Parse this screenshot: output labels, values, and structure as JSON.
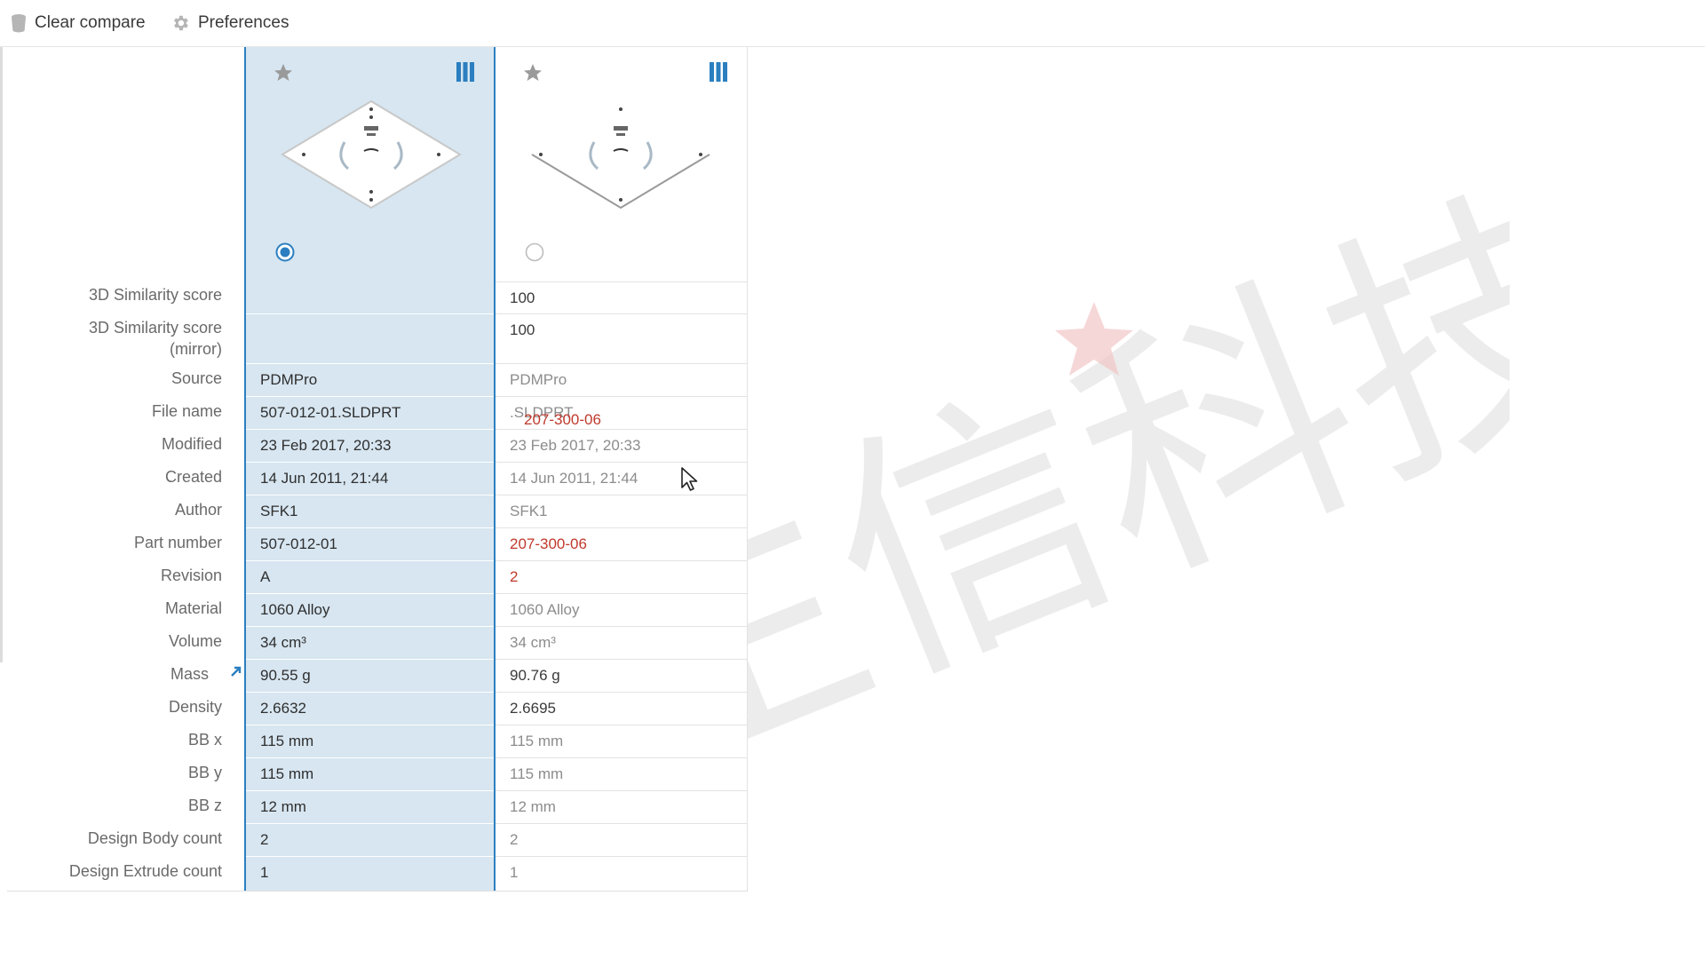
{
  "toolbar": {
    "clear_compare_label": "Clear compare",
    "preferences_label": "Preferences"
  },
  "labels": [
    "3D Similarity score",
    "3D Similarity score\n(mirror)",
    "Source",
    "File name",
    "Modified",
    "Created",
    "Author",
    "Part number",
    "Revision",
    "Material",
    "Volume",
    "Mass",
    "Density",
    "BB x",
    "BB y",
    "BB z",
    "Design Body count",
    "Design Extrude count"
  ],
  "column1": {
    "selected": true,
    "values": [
      "",
      "",
      "PDMPro",
      "507-012-01.SLDPRT",
      "23 Feb 2017, 20:33",
      "14 Jun 2011, 21:44",
      "SFK1",
      "507-012-01",
      "A",
      "1060 Alloy",
      "34 cm³",
      "90.55 g",
      "2.6632",
      "115 mm",
      "115 mm",
      "12 mm",
      "2",
      "1"
    ]
  },
  "column2": {
    "selected": false,
    "values": [
      "100",
      "100",
      "PDMPro",
      "",
      "23 Feb 2017, 20:33",
      "14 Jun 2011, 21:44",
      "SFK1",
      "207-300-06",
      "2",
      "1060 Alloy",
      "34 cm³",
      "90.76 g",
      "2.6695",
      "115 mm",
      "115 mm",
      "12 mm",
      "2",
      "1"
    ],
    "file_name_diff": "207-300-06",
    "file_name_ext": ".SLDPRT"
  },
  "icons": {
    "clear": "trash-icon",
    "prefs": "gear-icon",
    "star": "star-icon",
    "columns": "columns-icon",
    "mass": "arrow-up-right-icon"
  },
  "colors": {
    "selected_bg": "#d7e6f1",
    "accent": "#2b7fc0",
    "diff": "#c0392b"
  },
  "watermark": {
    "text": "生信科技"
  }
}
